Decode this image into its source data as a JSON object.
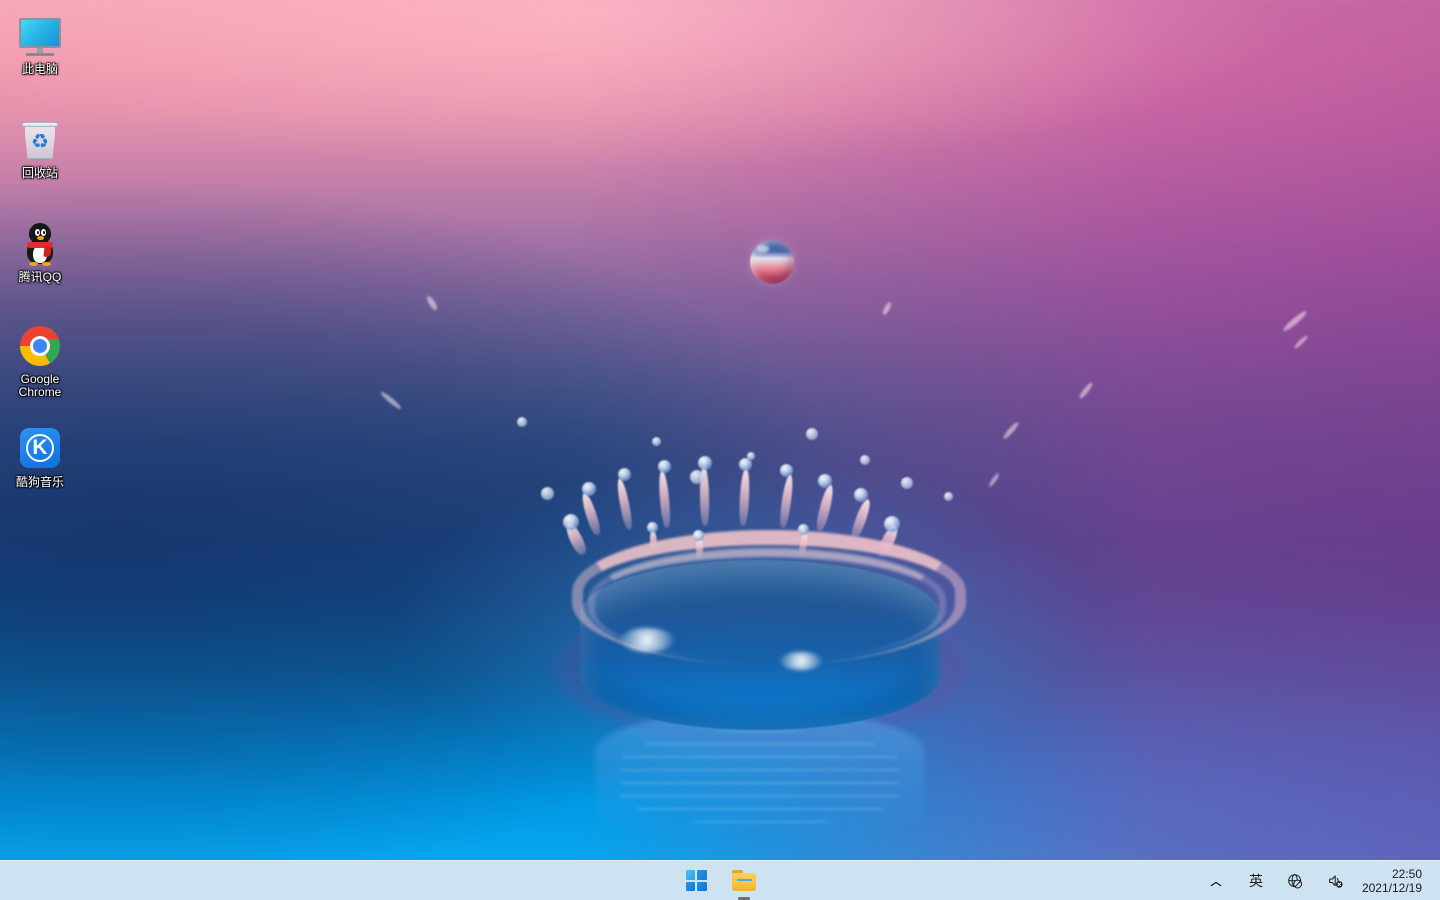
{
  "desktop": {
    "wallpaper": {
      "name": "water-drop-splash",
      "description": "Blue water drop splash crown on pink-to-purple-to-blue gradient background",
      "colors": {
        "top": "#f7a6b8",
        "mid_purple": "#8a6aa0",
        "navy": "#1f4a85",
        "bottom_azure": "#06a6ee",
        "right_magenta": "#a83a98"
      }
    },
    "icons": [
      {
        "id": "this-pc",
        "label": "此电脑",
        "icon": "monitor-icon"
      },
      {
        "id": "recycle-bin",
        "label": "回收站",
        "icon": "recycle-bin-icon"
      },
      {
        "id": "tencent-qq",
        "label": "腾讯QQ",
        "icon": "qq-penguin-icon"
      },
      {
        "id": "google-chrome",
        "label": "Google Chrome",
        "icon": "chrome-icon"
      },
      {
        "id": "kugou-music",
        "label": "酷狗音乐",
        "icon": "kugou-icon",
        "glyph": "K"
      }
    ]
  },
  "taskbar": {
    "background": "#cde3f2",
    "buttons": [
      {
        "id": "start",
        "label": "开始",
        "icon": "windows-logo-icon",
        "running": false
      },
      {
        "id": "file-explorer",
        "label": "文件资源管理器",
        "icon": "folder-icon",
        "running": true
      }
    ],
    "tray": {
      "show_hidden_label": "︿",
      "ime_label": "英",
      "network": {
        "icon": "globe-no-internet-icon",
        "label": "未连接到 Internet"
      },
      "volume": {
        "icon": "speaker-muted-icon",
        "label": "已静音"
      }
    },
    "clock": {
      "time": "22:50",
      "date": "2021/12/19"
    }
  }
}
